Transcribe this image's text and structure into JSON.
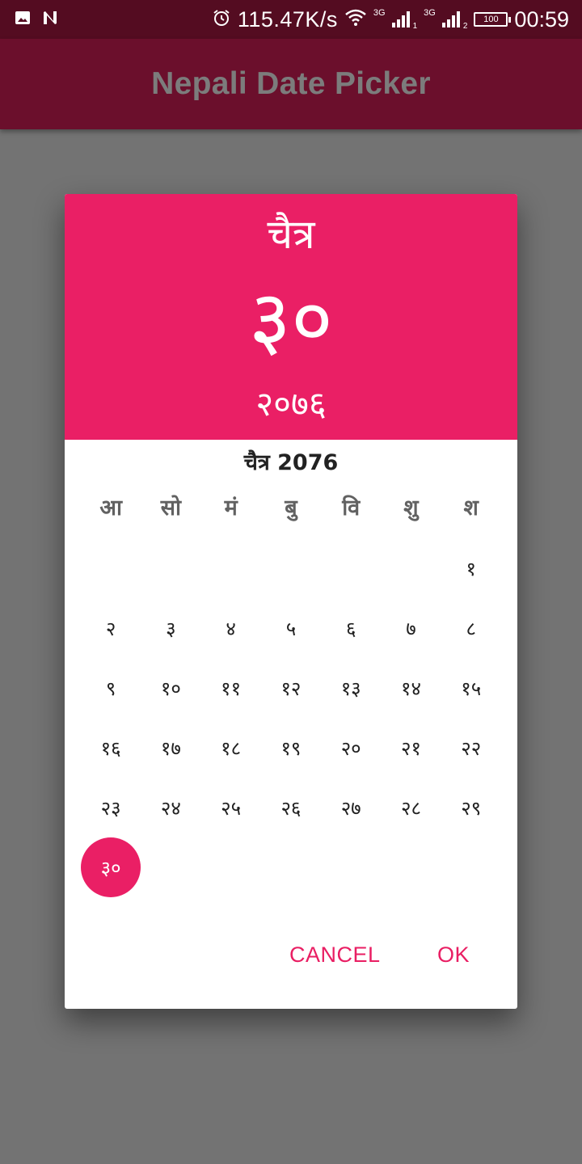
{
  "status_bar": {
    "speed": "115.47K/s",
    "network_1": "3G",
    "sim_1": "1",
    "network_2": "3G",
    "sim_2": "2",
    "battery": "100",
    "time": "00:59"
  },
  "app_bar": {
    "title": "Nepali Date Picker"
  },
  "dialog": {
    "header": {
      "month": "चैत्र",
      "day": "३०",
      "year": "२०७६"
    },
    "calendar_title": "चैत्र 2076",
    "weekdays": [
      "आ",
      "सो",
      "मं",
      "बु",
      "वि",
      "शु",
      "श"
    ],
    "weeks": [
      [
        "",
        "",
        "",
        "",
        "",
        "",
        "१"
      ],
      [
        "२",
        "३",
        "४",
        "५",
        "६",
        "७",
        "८"
      ],
      [
        "९",
        "१०",
        "११",
        "१२",
        "१३",
        "१४",
        "१५"
      ],
      [
        "१६",
        "१७",
        "१८",
        "१९",
        "२०",
        "२१",
        "२२"
      ],
      [
        "२३",
        "२४",
        "२५",
        "२६",
        "२७",
        "२८",
        "२९"
      ],
      [
        "३०",
        "",
        "",
        "",
        "",
        "",
        ""
      ]
    ],
    "selected_day": "३०",
    "cancel_label": "CANCEL",
    "ok_label": "OK"
  },
  "colors": {
    "status_bar": "#540c21",
    "app_bar": "#6b0f2c",
    "accent": "#ea1f65",
    "scrim": "#737373"
  }
}
